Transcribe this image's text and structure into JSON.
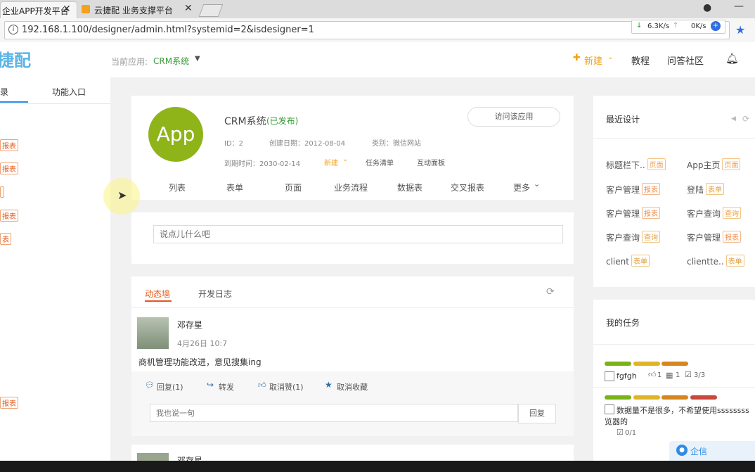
{
  "browser": {
    "tabs": [
      {
        "title": "企业APP开发平台"
      },
      {
        "title": "云捷配 业务支撑平台"
      }
    ],
    "url": "192.168.1.100/designer/admin.html?systemid=2&isdesigner=1",
    "speed_down": "6.3K/s",
    "speed_up": "0K/s"
  },
  "header": {
    "logo": "捷配",
    "current_app_label": "当前应用:",
    "current_app": "CRM系统",
    "new_label": "新建",
    "links": [
      "教程",
      "问答社区"
    ]
  },
  "sidebar": {
    "tabs": [
      "录",
      "功能入口"
    ],
    "tags": [
      "报表",
      "报表",
      "",
      "报表",
      "表",
      "报表"
    ]
  },
  "app": {
    "icon_text": "App",
    "name": "CRM系统",
    "status": "(已发布)",
    "visit_button": "访问该应用",
    "id": "ID：2",
    "created": "创建日期：2012-08-04",
    "category": "类别：微信网站",
    "expires": "到期时间：2030-02-14",
    "actions": [
      "新建",
      "任务清单",
      "互动面板"
    ],
    "nav": [
      "列表",
      "表单",
      "页面",
      "业务流程",
      "数据表",
      "交叉报表",
      "更多"
    ]
  },
  "compose": {
    "placeholder": "说点儿什么吧"
  },
  "feed": {
    "tabs": [
      "动态墙",
      "开发日志"
    ],
    "post": {
      "author": "邓存星",
      "time": "4月26日 10:7",
      "content": "商机管理功能改进，意见搜集ing",
      "actions": [
        "回复(1)",
        "转发",
        "取消赞(1)",
        "取消收藏"
      ],
      "reply_placeholder": "我也说一句",
      "reply_button": "回复"
    },
    "next_author": "邓存星"
  },
  "recent": {
    "title": "最近设计",
    "items": [
      {
        "name": "标题栏下..",
        "type": "页面"
      },
      {
        "name": "App主页",
        "type": "页面"
      },
      {
        "name": "客户管理",
        "type": "报表"
      },
      {
        "name": "登陆",
        "type": "表单"
      },
      {
        "name": "客户管理",
        "type": "报表"
      },
      {
        "name": "客户查询",
        "type": "查询"
      },
      {
        "name": "客户查询",
        "type": "查询"
      },
      {
        "name": "客户管理",
        "type": "报表"
      },
      {
        "name": "client",
        "type": "表单"
      },
      {
        "name": "clientte..",
        "type": "表单"
      }
    ]
  },
  "tasks": {
    "title": "我的任务",
    "items": [
      {
        "name": "fgfgh",
        "likes": "1",
        "comments": "1",
        "done": "3/3"
      },
      {
        "name": "数据量不是很多，不希望使用ssssssss",
        "extra": "览器的",
        "done": "0/1"
      }
    ],
    "colors": [
      "#7ab317",
      "#e0b427",
      "#d6861f",
      "#c9483a"
    ]
  },
  "chat": {
    "label": "企信"
  }
}
